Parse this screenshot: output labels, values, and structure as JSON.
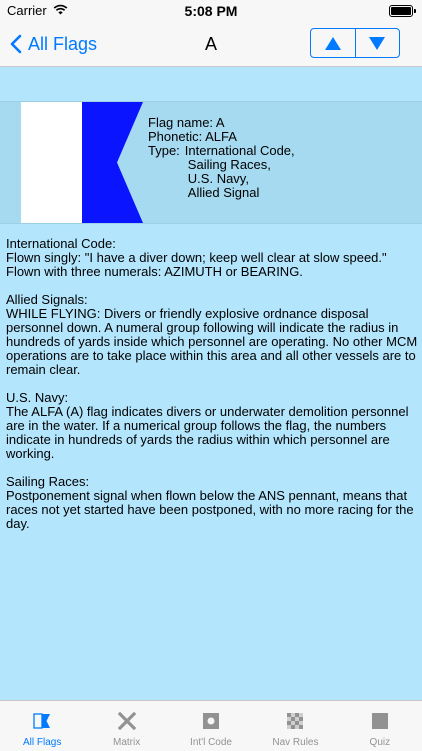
{
  "status": {
    "carrier": "Carrier",
    "time": "5:08 PM"
  },
  "nav": {
    "back_label": "All Flags",
    "title": "A"
  },
  "flag": {
    "name_line": "Flag name: A",
    "phonetic_line": "Phonetic: ALFA",
    "type_label": "Type:",
    "types": [
      "International Code,",
      "Sailing Races,",
      "U.S. Navy,",
      "Allied Signal"
    ],
    "colors": {
      "hoist": "#ffffff",
      "fly": "#0a14ff"
    }
  },
  "sections": [
    {
      "heading": "International Code:",
      "lines": [
        "Flown singly: \"I have a diver down; keep well clear at slow speed.\"",
        "Flown with three numerals: AZIMUTH or BEARING."
      ]
    },
    {
      "heading": "Allied Signals:",
      "lines": [
        "WHILE FLYING: Divers or friendly explosive ordnance disposal personnel down.  A numeral group following will indicate the radius in hundreds of yards inside which personnel are operating.  No other MCM operations are to take place within this area and all other vessels are to remain clear."
      ]
    },
    {
      "heading": "U.S. Navy:",
      "lines": [
        "The ALFA (A) flag indicates divers or underwater demolition personnel are in the water. If a numerical group follows the flag, the numbers indicate in hundreds of yards the radius within which personnel are working."
      ]
    },
    {
      "heading": "Sailing Races:",
      "lines": [
        "Postponement signal when flown below the ANS pennant, means that races not yet started have been postponed, with no more racing for the day."
      ]
    }
  ],
  "tabs": [
    {
      "label": "All Flags",
      "icon": "flag-a-icon",
      "active": true
    },
    {
      "label": "Matrix",
      "icon": "x-cross-icon",
      "active": false
    },
    {
      "label": "Int'l Code",
      "icon": "square-dot-icon",
      "active": false
    },
    {
      "label": "Nav Rules",
      "icon": "checkered-icon",
      "active": false
    },
    {
      "label": "Quiz",
      "icon": "square-icon",
      "active": false
    }
  ],
  "colors": {
    "accent": "#007aff",
    "background": "#b3e5fc",
    "tab_inactive": "#929292"
  }
}
